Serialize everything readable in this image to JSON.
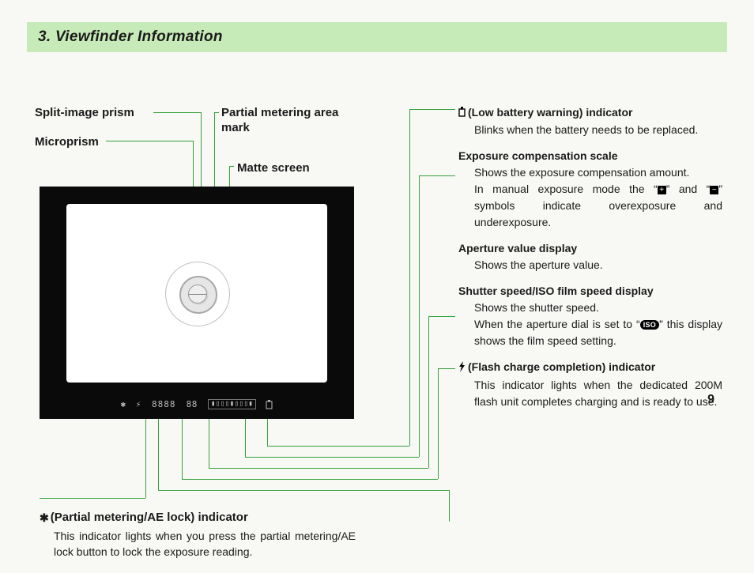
{
  "title": "3. Viewfinder Information",
  "labels": {
    "split": "Split-image prism",
    "micro": "Microprism",
    "partial": "Partial metering area mark",
    "matte": "Matte screen"
  },
  "leftFooter": {
    "star": "✱",
    "title": "(Partial metering/AE lock) indicator",
    "desc": "This indicator lights when you press the partial metering/AE lock button to lock the exposure reading."
  },
  "right": {
    "battery": {
      "title": "(Low battery warning) indicator",
      "desc": "Blinks when the battery needs to be replaced."
    },
    "expcomp": {
      "title": "Exposure compensation scale",
      "desc1": "Shows the exposure compensation amount.",
      "desc2a": "In manual exposure mode the “",
      "desc2b": "” and “",
      "desc2c": "” symbols indicate overexposure and underexposure."
    },
    "aperture": {
      "title": "Aperture value display",
      "desc": "Shows the aperture value."
    },
    "shutter": {
      "title": "Shutter speed/ISO film speed display",
      "desc1": "Shows the shutter speed.",
      "desc2a": "When the aperture dial is set to “",
      "desc2b": "” this display shows the film speed setting."
    },
    "flash": {
      "title": "(Flash charge completion) indicator",
      "desc": "This indicator lights when the dedicated 200M flash unit completes charging and is ready to use."
    }
  },
  "readout": {
    "star": "✱",
    "flash": "⚡",
    "digits": "8888",
    "aperture": "88",
    "scale": "▮▯▯▯▮▯▯▯▮"
  },
  "symbols": {
    "plus": "+",
    "minus": "−",
    "iso": "ISO"
  },
  "pageNumber": "9"
}
